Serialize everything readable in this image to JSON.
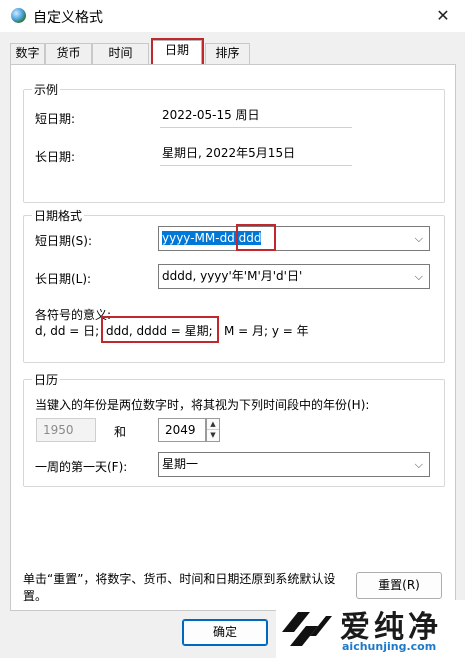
{
  "window": {
    "title": "自定义格式",
    "close_glyph": "✕"
  },
  "tabs": [
    {
      "label": "数字",
      "active": false
    },
    {
      "label": "货币",
      "active": false
    },
    {
      "label": "时间",
      "active": false
    },
    {
      "label": "日期",
      "active": true
    },
    {
      "label": "排序",
      "active": false
    }
  ],
  "example": {
    "title": "示例",
    "short_label": "短日期:",
    "short_value": "2022-05-15 周日",
    "long_label": "长日期:",
    "long_value": "星期日, 2022年5月15日"
  },
  "date_format": {
    "title": "日期格式",
    "short_label": "短日期(S):",
    "short_value_part1": "yyyy-MM-dd",
    "short_value_part2": "ddd",
    "long_label": "长日期(L):",
    "long_value": "dddd, yyyy'年'M'月'd'日'",
    "symbols_title": "各符号的意义:",
    "symbols_part1": "d, dd = 日;",
    "symbols_part2": "ddd, dddd = 星期;",
    "symbols_part3": "M = 月;  y = 年"
  },
  "calendar": {
    "title": "日历",
    "two_digit_text": "当键入的年份是两位数字时，将其视为下列时间段中的年份(H):",
    "year_from": "1950",
    "and_label": "和",
    "year_to": "2049",
    "first_day_label": "一周的第一天(F):",
    "first_day_value": "星期一"
  },
  "footer": {
    "reset_note": "单击“重置”，将数字、货币、时间和日期还原到系统默认设置。",
    "reset_button": "重置(R)",
    "ok_button": "确定"
  },
  "watermark": {
    "brand": "爱纯净",
    "url": "aichunjing.com"
  },
  "colors": {
    "highlight": "#c0282e",
    "selection": "#0078d7",
    "accent": "#0067c0"
  },
  "icons": {
    "dropdown": "chevron-down-icon",
    "spin_up": "▲",
    "spin_down": "▼",
    "chevron": "⌵"
  }
}
